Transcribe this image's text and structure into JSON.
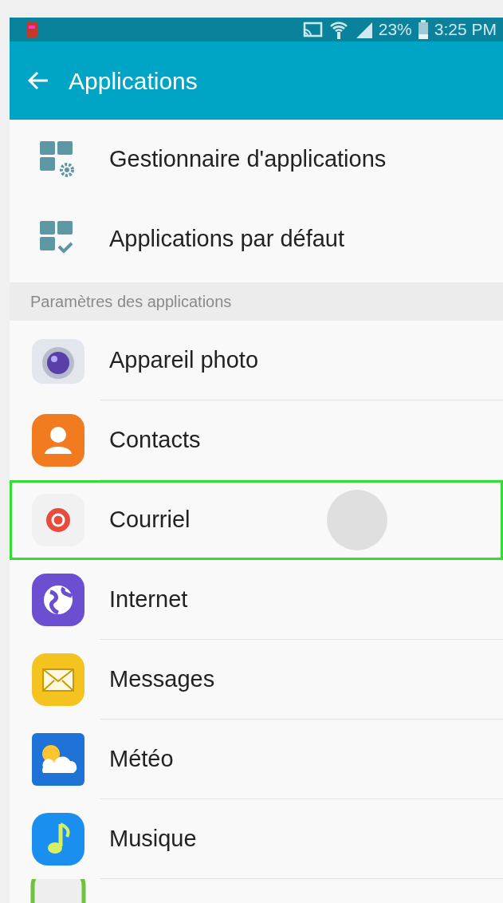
{
  "status_bar": {
    "battery": "23%",
    "time": "3:25 PM"
  },
  "app_bar": {
    "title": "Applications"
  },
  "top_items": [
    {
      "label": "Gestionnaire d'applications",
      "kind": "manager"
    },
    {
      "label": "Applications par défaut",
      "kind": "defaults"
    }
  ],
  "section_header": "Paramètres des applications",
  "app_items": [
    {
      "label": "Appareil photo",
      "kind": "camera",
      "highlighted": false
    },
    {
      "label": "Contacts",
      "kind": "contacts",
      "highlighted": false
    },
    {
      "label": "Courriel",
      "kind": "email",
      "highlighted": true
    },
    {
      "label": "Internet",
      "kind": "internet",
      "highlighted": false
    },
    {
      "label": "Messages",
      "kind": "messages",
      "highlighted": false
    },
    {
      "label": "Météo",
      "kind": "weather",
      "highlighted": false
    },
    {
      "label": "Musique",
      "kind": "music",
      "highlighted": false
    },
    {
      "kind": "partial",
      "highlighted": false
    }
  ]
}
